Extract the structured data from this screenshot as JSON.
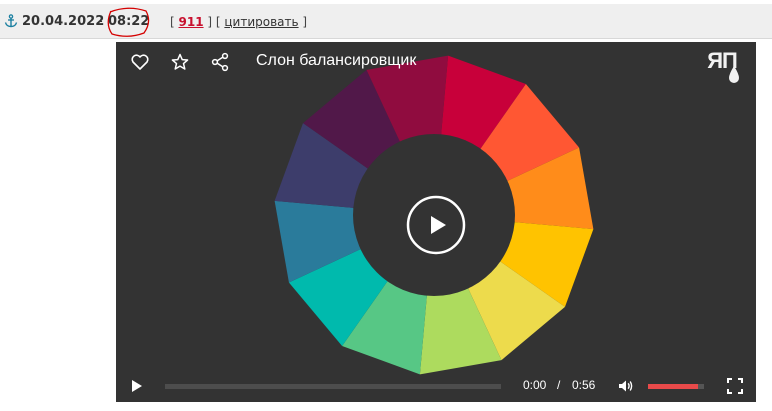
{
  "post": {
    "date": "20.04.2022",
    "separator": "-",
    "time": "08:22",
    "bracket_open": "[ ",
    "bracket_mid": " ] [ ",
    "bracket_close": " ]",
    "comment_count": "911",
    "quote_label": "цитировать"
  },
  "player": {
    "title": "Слон балансировщик",
    "logo_text": "ЯП",
    "current_time": "0:00",
    "time_separator": "/",
    "total_time": "0:56",
    "progress": 0.0,
    "volume": 0.9,
    "accent_color": "#e84a4a",
    "icons": [
      "heart-icon",
      "star-icon",
      "share-icon",
      "play-icon",
      "volume-icon",
      "fullscreen-icon"
    ],
    "wheel_colors": [
      "#c8003a",
      "#ff5733",
      "#ff8c1a",
      "#ffc300",
      "#eddb4c",
      "#addb5e",
      "#57c785",
      "#00baad",
      "#2a7b9b",
      "#3d3d6b",
      "#511849",
      "#900c3f"
    ]
  }
}
